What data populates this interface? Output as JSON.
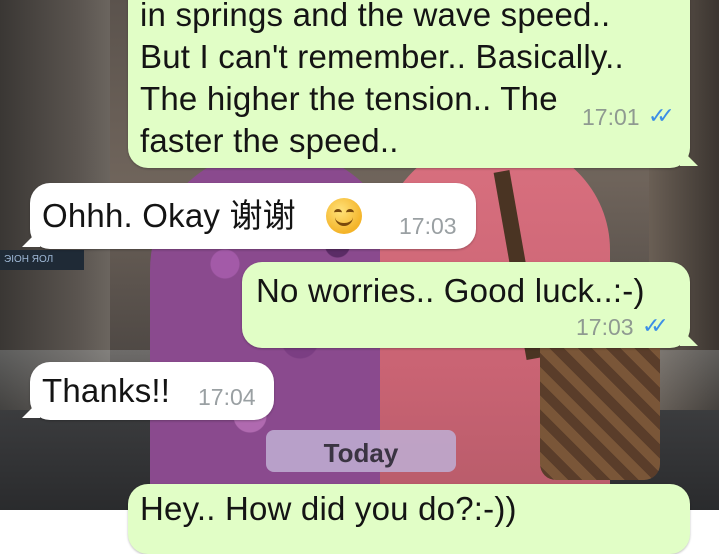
{
  "chat": {
    "messages": [
      {
        "direction": "outgoing",
        "text": "in springs and the wave speed..\nBut I can't remember.. Basically..\nThe higher the tension.. The\nfaster the speed..",
        "time": "17:01",
        "status": "read"
      },
      {
        "direction": "incoming",
        "text": "Ohhh. Okay 谢谢",
        "emoji": "smiling-face-icon",
        "time": "17:03"
      },
      {
        "direction": "outgoing",
        "text": "No worries.. Good luck..:-)",
        "time": "17:03",
        "status": "read"
      },
      {
        "direction": "incoming",
        "text": "Thanks!!",
        "time": "17:04"
      },
      {
        "direction": "outgoing",
        "text": "Hey.. How did you do?:-))",
        "partial": true
      }
    ],
    "day_separator": "Today",
    "read_check_glyph": "✓✓",
    "colors": {
      "outgoing_bubble": "#e1fec6",
      "incoming_bubble": "#ffffff",
      "read_checks": "#3c8ee6",
      "day_pill": "#beacd2"
    }
  },
  "wallpaper": {
    "sign_text": "ЭІОН ЯОЛ"
  }
}
